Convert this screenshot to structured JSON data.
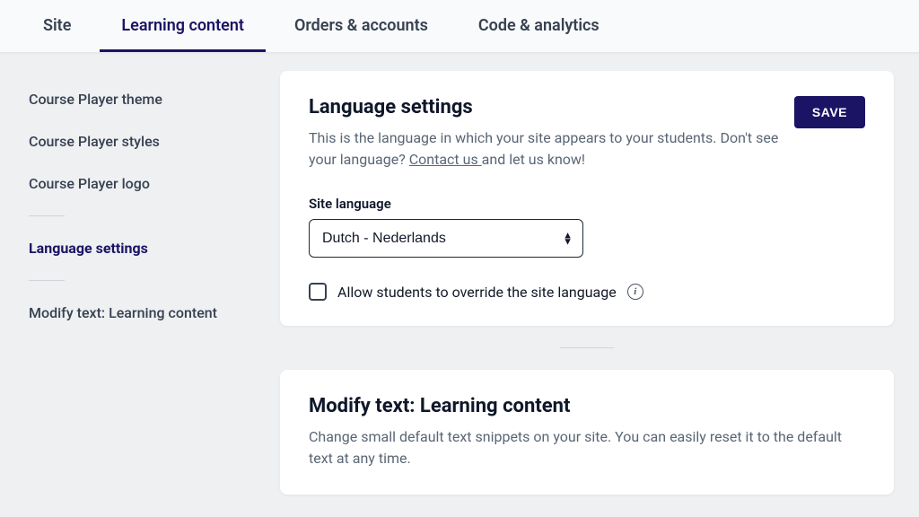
{
  "tabs": {
    "site": "Site",
    "learning": "Learning content",
    "orders": "Orders & accounts",
    "code": "Code & analytics"
  },
  "sidebar": {
    "theme": "Course Player theme",
    "styles": "Course Player styles",
    "logo": "Course Player logo",
    "language": "Language settings",
    "modify": "Modify text: Learning content"
  },
  "lang_card": {
    "title": "Language settings",
    "desc1": "This is the language in which your site appears to your students. Don't see your language? ",
    "contact": "Contact us ",
    "desc2": "and let us know!",
    "save": "SAVE",
    "field_label": "Site language",
    "selected": "Dutch - Nederlands",
    "checkbox_label": "Allow students to override the site language"
  },
  "modify_card": {
    "title": "Modify text: Learning content",
    "desc": "Change small default text snippets on your site. You can easily reset it to the default text at any time."
  }
}
